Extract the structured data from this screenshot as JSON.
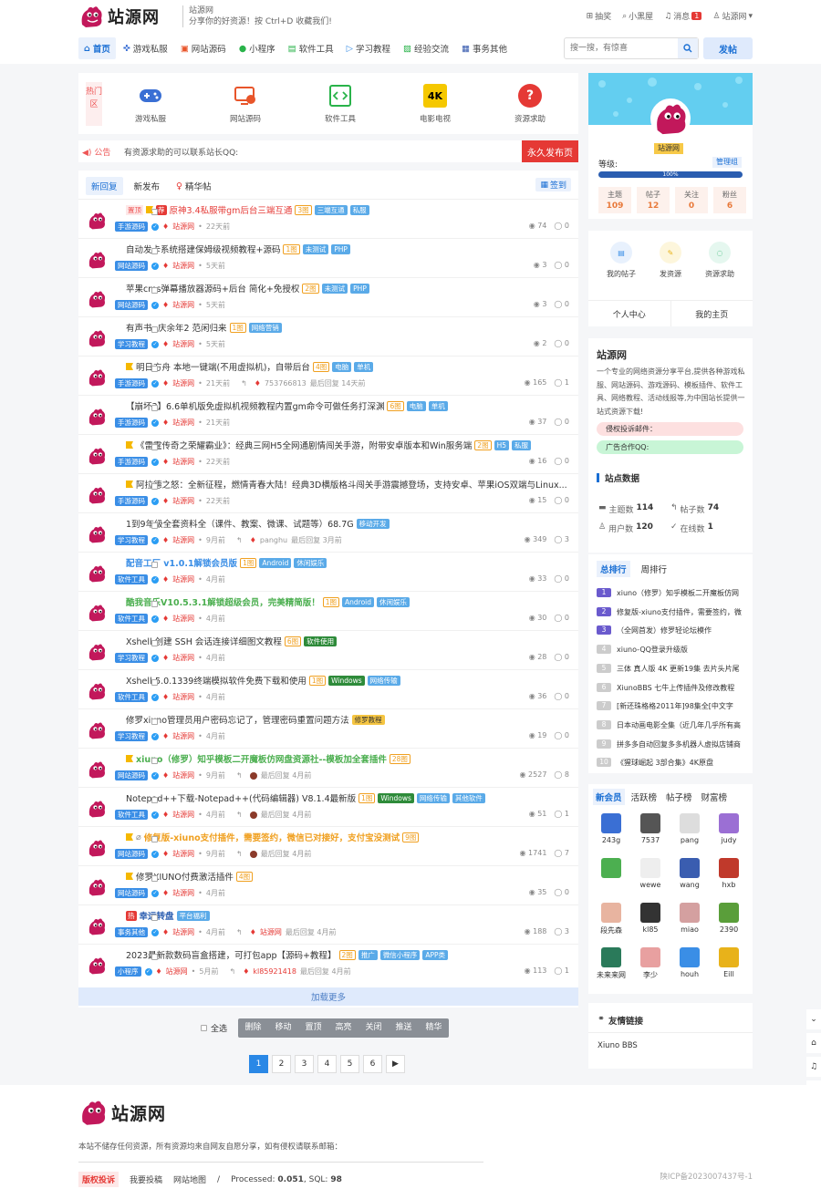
{
  "header": {
    "logo_text": "站源网",
    "site_name": "站源网",
    "slogan": "分享你的好资源！按 Ctrl+D 收藏我们!",
    "top_links": [
      {
        "label": "抽奖",
        "icon": "gift-icon"
      },
      {
        "label": "小黑屋",
        "icon": "lock-icon"
      },
      {
        "label": "消息",
        "icon": "bell-icon",
        "badge": "1"
      },
      {
        "label": "站源网",
        "icon": "user-icon"
      }
    ]
  },
  "nav": {
    "items": [
      {
        "label": "首页",
        "icon": "home-icon",
        "color": "#1a6fd4"
      },
      {
        "label": "游戏私服",
        "icon": "gamepad-icon",
        "color": "#3a6fd4"
      },
      {
        "label": "网站源码",
        "icon": "website-icon",
        "color": "#e8552a"
      },
      {
        "label": "小程序",
        "icon": "miniprogram-icon",
        "color": "#29b34a"
      },
      {
        "label": "软件工具",
        "icon": "code-icon",
        "color": "#29b34a"
      },
      {
        "label": "学习教程",
        "icon": "play-icon",
        "color": "#3a8ee6"
      },
      {
        "label": "经验交流",
        "icon": "image-icon",
        "color": "#29b34a"
      },
      {
        "label": "事务其他",
        "icon": "grid-icon",
        "color": "#3a5db0"
      }
    ],
    "search_placeholder": "搜一搜，有惊喜",
    "post_label": "发帖"
  },
  "hot_zone": {
    "label": "热门区",
    "items": [
      {
        "label": "游戏私服",
        "icon": "gamepad-icon"
      },
      {
        "label": "网站源码",
        "icon": "website-icon"
      },
      {
        "label": "软件工具",
        "icon": "code-icon"
      },
      {
        "label": "电影电视",
        "icon": "4k-icon",
        "icon_text": "4K"
      },
      {
        "label": "资源求助",
        "icon": "help-icon",
        "icon_text": "?"
      }
    ]
  },
  "notice": {
    "label": "公告",
    "text": "有资源求助的可以联系站长QQ:",
    "button": "永久发布页"
  },
  "thread_tabs": [
    "新回复",
    "新发布",
    "精华帖"
  ],
  "sign_label": "签到",
  "threads": [
    {
      "top": "置顶",
      "flag": true,
      "rec": "荐",
      "title": "原神3.4私服带gm后台三端互通",
      "style": "red",
      "imgs": "3图",
      "tags": [
        "三端互通",
        "私服"
      ],
      "category": "手游源码",
      "author": "站源网",
      "time": "22天前",
      "views": "74",
      "replies": "0"
    },
    {
      "title": "自动发卡系统搭建保姆级视频教程+源码",
      "imgs": "1图",
      "tags": [
        "未测试",
        "PHP"
      ],
      "category": "网站源码",
      "author": "站源网",
      "time": "5天前",
      "views": "3",
      "replies": "0"
    },
    {
      "title": "苹果cms弹幕播放器源码+后台 简化+免授权",
      "imgs": "2图",
      "tags": [
        "未测试",
        "PHP"
      ],
      "category": "网站源码",
      "author": "站源网",
      "time": "5天前",
      "views": "3",
      "replies": "0"
    },
    {
      "title": "有声书 -庆余年2 范闲归来",
      "imgs": "1图",
      "tags": [
        "网络营销"
      ],
      "category": "学习教程",
      "author": "站源网",
      "time": "5天前",
      "views": "2",
      "replies": "0"
    },
    {
      "flag": true,
      "title": "明日方舟 本地一键端(不用虚拟机)，自带后台",
      "imgs": "4图",
      "tags": [
        "电脑",
        "单机"
      ],
      "category": "手游源码",
      "author": "站源网",
      "time": "21天前",
      "last_user": "753766813",
      "last_time": "最后回复 14天前",
      "views": "165",
      "replies": "1"
    },
    {
      "title": "【崩坏3】6.6单机版免虚拟机视频教程内置gm命令可做任务打深渊",
      "imgs": "6图",
      "tags": [
        "电脑",
        "单机"
      ],
      "category": "手游源码",
      "author": "站源网",
      "time": "21天前",
      "views": "37",
      "replies": "0"
    },
    {
      "flag": true,
      "title": "《雷霆传奇之荣耀霸业》：经典三网H5全网通剧情闯关手游，附带安卓版本和Win服务端",
      "imgs": "2图",
      "tags": [
        "H5",
        "私服"
      ],
      "category": "手游源码",
      "author": "站源网",
      "time": "22天前",
      "views": "16",
      "replies": "0"
    },
    {
      "flag": true,
      "title": "阿拉德之怒：全新征程，燃情青春大陆！经典3D横版格斗闯关手游震撼登场，支持安卓、苹果iOS双端与Linux...",
      "imgs": "",
      "tags": [],
      "category": "手游源码",
      "author": "站源网",
      "time": "22天前",
      "views": "15",
      "replies": "0"
    },
    {
      "title": "1到9年级全套资料全（课件、教案、微课、试题等）68.7G",
      "imgs": "",
      "tags": [
        "移动开发"
      ],
      "category": "学习教程",
      "author": "站源网",
      "time": "9月前",
      "last_user": "panghu",
      "last_time": "最后回复 3月前",
      "views": "349",
      "replies": "3"
    },
    {
      "title": "配音工厂 v1.0.1解锁会员版",
      "style": "blue",
      "imgs": "1图",
      "tags": [
        "Android",
        "休闲娱乐"
      ],
      "category": "软件工具",
      "author": "站源网",
      "time": "4月前",
      "views": "33",
      "replies": "0"
    },
    {
      "title": "酷我音乐V10.5.3.1解锁超级会员，完美精简版！",
      "style": "green",
      "imgs": "1图",
      "tags": [
        "Android",
        "休闲娱乐"
      ],
      "category": "软件工具",
      "author": "站源网",
      "time": "4月前",
      "views": "30",
      "replies": "0"
    },
    {
      "title": "Xshell 创建 SSH 会话连接详细图文教程",
      "imgs": "6图",
      "tags": [
        "软件使用"
      ],
      "tag_style": "g",
      "category": "学习教程",
      "author": "站源网",
      "time": "4月前",
      "views": "28",
      "replies": "0"
    },
    {
      "title": "Xshell-5.0.1339终端模拟软件免费下载和使用",
      "imgs": "1图",
      "tags": [
        "Windows",
        "网络传输"
      ],
      "tag_style": "g1",
      "category": "软件工具",
      "author": "站源网",
      "time": "4月前",
      "views": "36",
      "replies": "0"
    },
    {
      "title": "修罗xiuno管理员用户密码忘记了，管理密码重置问题方法",
      "imgs": "",
      "tags": [
        "修罗教程"
      ],
      "tag_style": "y",
      "category": "学习教程",
      "author": "站源网",
      "time": "4月前",
      "views": "19",
      "replies": "0"
    },
    {
      "flag": true,
      "title": "xiuno（修罗）知乎模板二开魔板仿网盘资源社--模板加全套插件",
      "style": "green",
      "imgs": "28图",
      "tags": [],
      "category": "网站源码",
      "author": "站源网",
      "time": "9月前",
      "last_user": "",
      "last_time": "最后回复 4月前",
      "views": "2527",
      "replies": "8"
    },
    {
      "title": "Notepad++下载-Notepad++(代码编辑器) V8.1.4最新版",
      "imgs": "1图",
      "tags": [
        "Windows",
        "网络传输",
        "其他软件"
      ],
      "tag_style": "g1",
      "category": "软件工具",
      "author": "站源网",
      "time": "4月前",
      "last_user": "",
      "last_time": "最后回复 4月前",
      "views": "51",
      "replies": "1"
    },
    {
      "flag": true,
      "clip": true,
      "title": "修复版-xiuno支付插件，需要签约，微信已对接好，支付宝没测试",
      "style": "orange",
      "imgs": "9图",
      "tags": [],
      "category": "网站源码",
      "author": "站源网",
      "time": "9月前",
      "last_user": "",
      "last_time": "最后回复 4月前",
      "views": "1741",
      "replies": "7"
    },
    {
      "flag": true,
      "title": "修罗XIUNO付费激活插件",
      "imgs": "4图",
      "tags": [],
      "category": "网站源码",
      "author": "站源网",
      "time": "4月前",
      "views": "35",
      "replies": "0"
    },
    {
      "hot": "热",
      "title": "幸运转盘",
      "style": "bolddark",
      "imgs": "",
      "tags": [
        "平台福利"
      ],
      "category": "事务其他",
      "author": "站源网",
      "time": "4月前",
      "last_user": "站源网",
      "last_time": "最后回复 4月前",
      "views": "188",
      "replies": "3"
    },
    {
      "title": "2023最新款数码盲盒搭建，可打包app【源码+教程】",
      "imgs": "2图",
      "tags": [
        "推广",
        "微信小程序",
        "APP类"
      ],
      "category": "小程序",
      "author": "站源网",
      "time": "5月前",
      "last_user": "kl85921418",
      "last_time": "最后回复 4月前",
      "views": "113",
      "replies": "1"
    }
  ],
  "load_more": "加载更多",
  "bulk": {
    "select_all": "全选",
    "actions": [
      "删除",
      "移动",
      "置顶",
      "高亮",
      "关闭",
      "推送",
      "精华"
    ]
  },
  "pagination": [
    "1",
    "2",
    "3",
    "4",
    "5",
    "6",
    "▶"
  ],
  "profile": {
    "name": "站源网",
    "level_label": "等级:",
    "role": "管理组",
    "progress_text": "100%",
    "progress": 1.0,
    "stats": [
      {
        "label": "主题",
        "value": "109"
      },
      {
        "label": "帖子",
        "value": "12"
      },
      {
        "label": "关注",
        "value": "0"
      },
      {
        "label": "粉丝",
        "value": "6"
      }
    ]
  },
  "quick": {
    "items": [
      {
        "label": "我的帖子",
        "icon": "document-icon",
        "bg": "#e8f1fd",
        "color": "#3a8ee6"
      },
      {
        "label": "发资源",
        "icon": "edit-icon",
        "bg": "#fdf6dc",
        "color": "#e8b21a"
      },
      {
        "label": "资源求助",
        "icon": "help-chat-icon",
        "bg": "#e5f7ef",
        "color": "#29b36a"
      }
    ],
    "links": [
      "个人中心",
      "我的主页"
    ]
  },
  "about": {
    "title": "站源网",
    "desc": "一个专业的网络资源分享平台,提供各种游戏私服、网站源码、游戏源码、模板插件、软件工具、网络教程、活动线报等,为中国站长提供一站式资源下载!",
    "complaint": "侵权投诉邮件：",
    "ads": "广告合作QQ:",
    "stats_title": "站点数据",
    "stats": [
      {
        "label": "主题数",
        "value": "114",
        "icon": "chat-icon"
      },
      {
        "label": "帖子数",
        "value": "74",
        "icon": "reply-icon"
      },
      {
        "label": "用户数",
        "value": "120",
        "icon": "user-icon"
      },
      {
        "label": "在线数",
        "value": "1",
        "icon": "check-icon"
      }
    ]
  },
  "ranking": {
    "tabs": [
      "总排行",
      "周排行"
    ],
    "items": [
      "xiuno（修罗）知乎模板二开魔板仿网",
      "修复版-xiuno支付插件，需要签约，微",
      "（全网首发）修罗轻论坛模作",
      "xiuno-QQ登录升级版",
      "三体 真人版 4K 更新19集 去片头片尾",
      "XiunoBBS 七牛上传插件及修改教程",
      "[新还珠格格2011年]98集全[中文字",
      "日本动画电影全集（近几年几乎所有高",
      "拼多多自动回复多多机器人虚拟店铺商",
      "《猩球崛起 3部合集》4K原盘"
    ]
  },
  "members": {
    "tabs": [
      "新会员",
      "活跃榜",
      "帖子榜",
      "财富榜"
    ],
    "items": [
      {
        "name": "243g",
        "color": "#3a6fd4"
      },
      {
        "name": "7537",
        "color": "#555555"
      },
      {
        "name": "pang",
        "color": "#dddddd"
      },
      {
        "name": "judy",
        "color": "#9b6fd4"
      },
      {
        "name": "",
        "color": "#4caf50"
      },
      {
        "name": "wewe",
        "color": "#eeeeee"
      },
      {
        "name": "wang",
        "color": "#3a5db0"
      },
      {
        "name": "hxb",
        "color": "#c0392b"
      },
      {
        "name": "段先森",
        "color": "#e8b4a0"
      },
      {
        "name": "kl85",
        "color": "#333333"
      },
      {
        "name": "miao",
        "color": "#d4a0a0"
      },
      {
        "name": "2390",
        "color": "#5a9e3a"
      },
      {
        "name": "未来来网",
        "color": "#2a7a5a"
      },
      {
        "name": "李少",
        "color": "#e8a0a0"
      },
      {
        "name": "houh",
        "color": "#3a8ee6"
      },
      {
        "name": "Eill",
        "color": "#e8b21a"
      }
    ]
  },
  "friend_links": {
    "title": "友情链接",
    "items": [
      "Xiuno BBS"
    ]
  },
  "footer": {
    "logo_text": "站源网",
    "note": "本站不储存任何资源，所有资源均来自网友自愿分享，如有侵权请联系邮箱：",
    "links": [
      "版权投诉",
      "我要投稿",
      "网站地图",
      "/"
    ],
    "processed_label": "Processed:",
    "processed_value": "0.051",
    "sql_label": "SQL:",
    "sql_value": "98",
    "icp": "陕ICP备2023007437号-1"
  }
}
